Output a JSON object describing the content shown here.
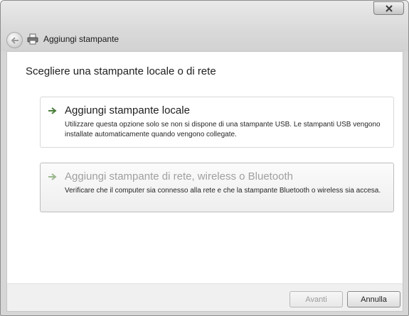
{
  "window": {
    "title": "Aggiungi stampante",
    "heading": "Scegliere una stampante locale o di rete"
  },
  "options": [
    {
      "title": "Aggiungi stampante locale",
      "description": "Utilizzare questa opzione solo se non si dispone di una stampante USB. Le stampanti USB vengono installate automaticamente quando vengono collegate.",
      "enabled": true
    },
    {
      "title": "Aggiungi stampante di rete, wireless o Bluetooth",
      "description": "Verificare che il computer sia connesso alla rete e che la stampante Bluetooth o wireless sia accesa.",
      "enabled": false
    }
  ],
  "buttons": {
    "next": "Avanti",
    "cancel": "Annulla"
  },
  "icons": {
    "close": "close-icon",
    "back": "back-arrow-icon",
    "printer": "printer-icon",
    "option_arrow": "green-arrow-icon"
  }
}
